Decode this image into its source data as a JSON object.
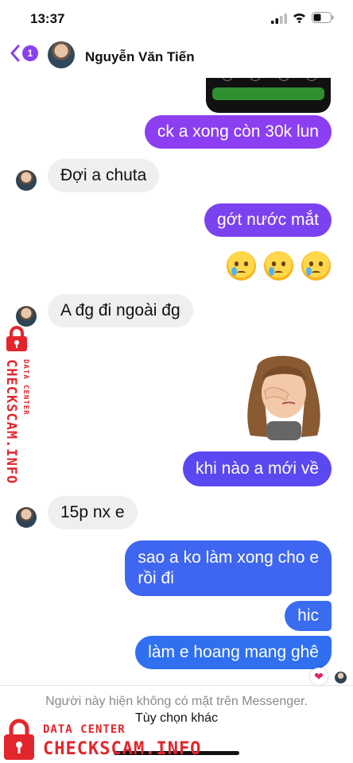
{
  "status_bar": {
    "time": "13:37"
  },
  "header": {
    "back_count": "1",
    "contact_name": "Nguyễn Văn Tiến"
  },
  "messages": [
    {
      "direction": "out",
      "text": "ck a xong còn 30k lun"
    },
    {
      "direction": "in",
      "text": "Đợi a chuta"
    },
    {
      "direction": "out",
      "text": "gớt nước mắt"
    },
    {
      "direction": "in",
      "text": "A đg đi ngoài đg"
    },
    {
      "direction": "out",
      "text": "khi nào a mới về"
    },
    {
      "direction": "in",
      "text": "15p nx e"
    },
    {
      "direction": "out",
      "text": "sao a ko làm xong cho e"
    },
    {
      "direction": "out",
      "text": "rồi đi"
    },
    {
      "direction": "out",
      "text": "hic"
    },
    {
      "direction": "out",
      "text": "làm e hoang mang ghê"
    }
  ],
  "reactions": {
    "last_message": "❤"
  },
  "footer": {
    "notice": "Người này hiện không có mặt trên Messenger.",
    "options": "Tùy chọn khác"
  },
  "watermark": {
    "small": "DATA CENTER",
    "big": "CHECKSCAM.INFO"
  },
  "colors": {
    "accent": "#8a3ff0",
    "bubble_purple": "#8b3ff0",
    "bubble_blue_violet": "#6247f0",
    "bubble_blue": "#2f6ff0",
    "incoming_bubble": "#efefef",
    "watermark_red": "#e3262c"
  }
}
